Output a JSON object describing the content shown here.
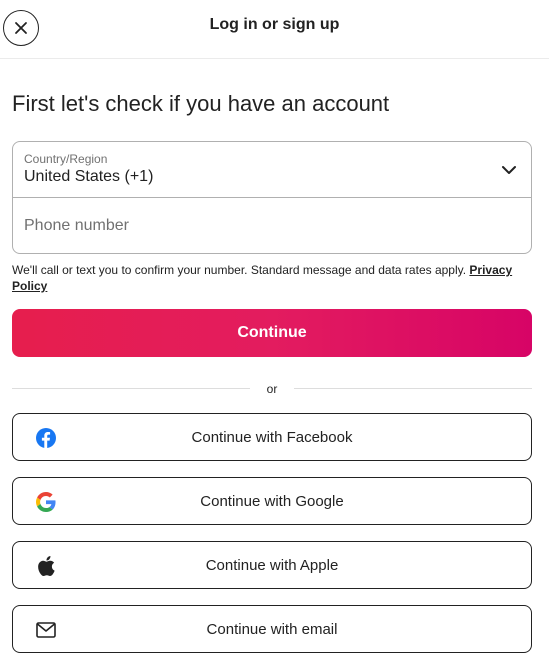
{
  "header": {
    "title": "Log in or sign up"
  },
  "main": {
    "heading": "First let's check if you have an account",
    "country": {
      "label": "Country/Region",
      "value": "United States (+1)"
    },
    "phone": {
      "placeholder": "Phone number",
      "value": ""
    },
    "disclaimer": {
      "text": "We'll call or text you to confirm your number. Standard message and data rates apply. ",
      "link": "Privacy Policy"
    },
    "continue_label": "Continue",
    "divider_text": "or",
    "social": {
      "facebook": "Continue with Facebook",
      "google": "Continue with Google",
      "apple": "Continue with Apple",
      "email": "Continue with email"
    }
  },
  "colors": {
    "brand_start": "#e61e4d",
    "brand_end": "#d70466",
    "facebook_blue": "#1877f2",
    "text": "#222222",
    "muted": "#717171",
    "border": "#b0b0b0"
  }
}
